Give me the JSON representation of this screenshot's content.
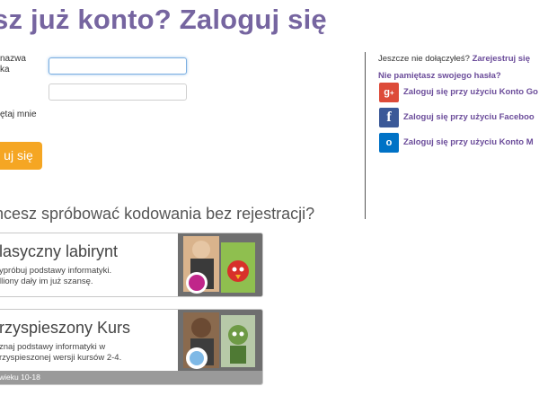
{
  "header": {
    "title": "sz już konto? Zaloguj się"
  },
  "login_form": {
    "username_label_line1": "nazwa",
    "username_label_line2": "ka",
    "username_value": "",
    "password_value": "",
    "remember_label": "ętaj mnie",
    "signin_label": "uj się"
  },
  "side": {
    "join_prefix": "Jeszcze nie dołączyłeś?",
    "join_link": "Zarejestruj się",
    "forgot_link": "Nie pamiętasz swojego hasła?",
    "social": [
      {
        "label": "Zaloguj się przy użyciu Konto Go",
        "icon": "google-plus-icon",
        "color": "#dd4b39"
      },
      {
        "label": "Zaloguj się przy użyciu Faceboo",
        "icon": "facebook-icon",
        "color": "#3b5998"
      },
      {
        "label": "Zaloguj się przy użyciu Konto  M",
        "icon": "microsoft-outlook-icon",
        "color": "#0072c6"
      }
    ]
  },
  "try": {
    "heading": "hcesz spróbować kodowania bez rejestracji?",
    "cards": [
      {
        "title": "lasyczny labirynt",
        "desc_line1": "ypróbuj podstawy informatyki.",
        "desc_line2": "lliony dały im już szansę.",
        "footer": ""
      },
      {
        "title": "rzyspieszony Kurs",
        "desc_line1": "znaj podstawy informatyki w",
        "desc_line2": "rzyspieszonej wersji kursów 2-4.",
        "footer": "wieku 10-18"
      }
    ]
  },
  "colors": {
    "accent": "#7665a0",
    "button": "#f5a623",
    "link": "#6b4c9a"
  }
}
